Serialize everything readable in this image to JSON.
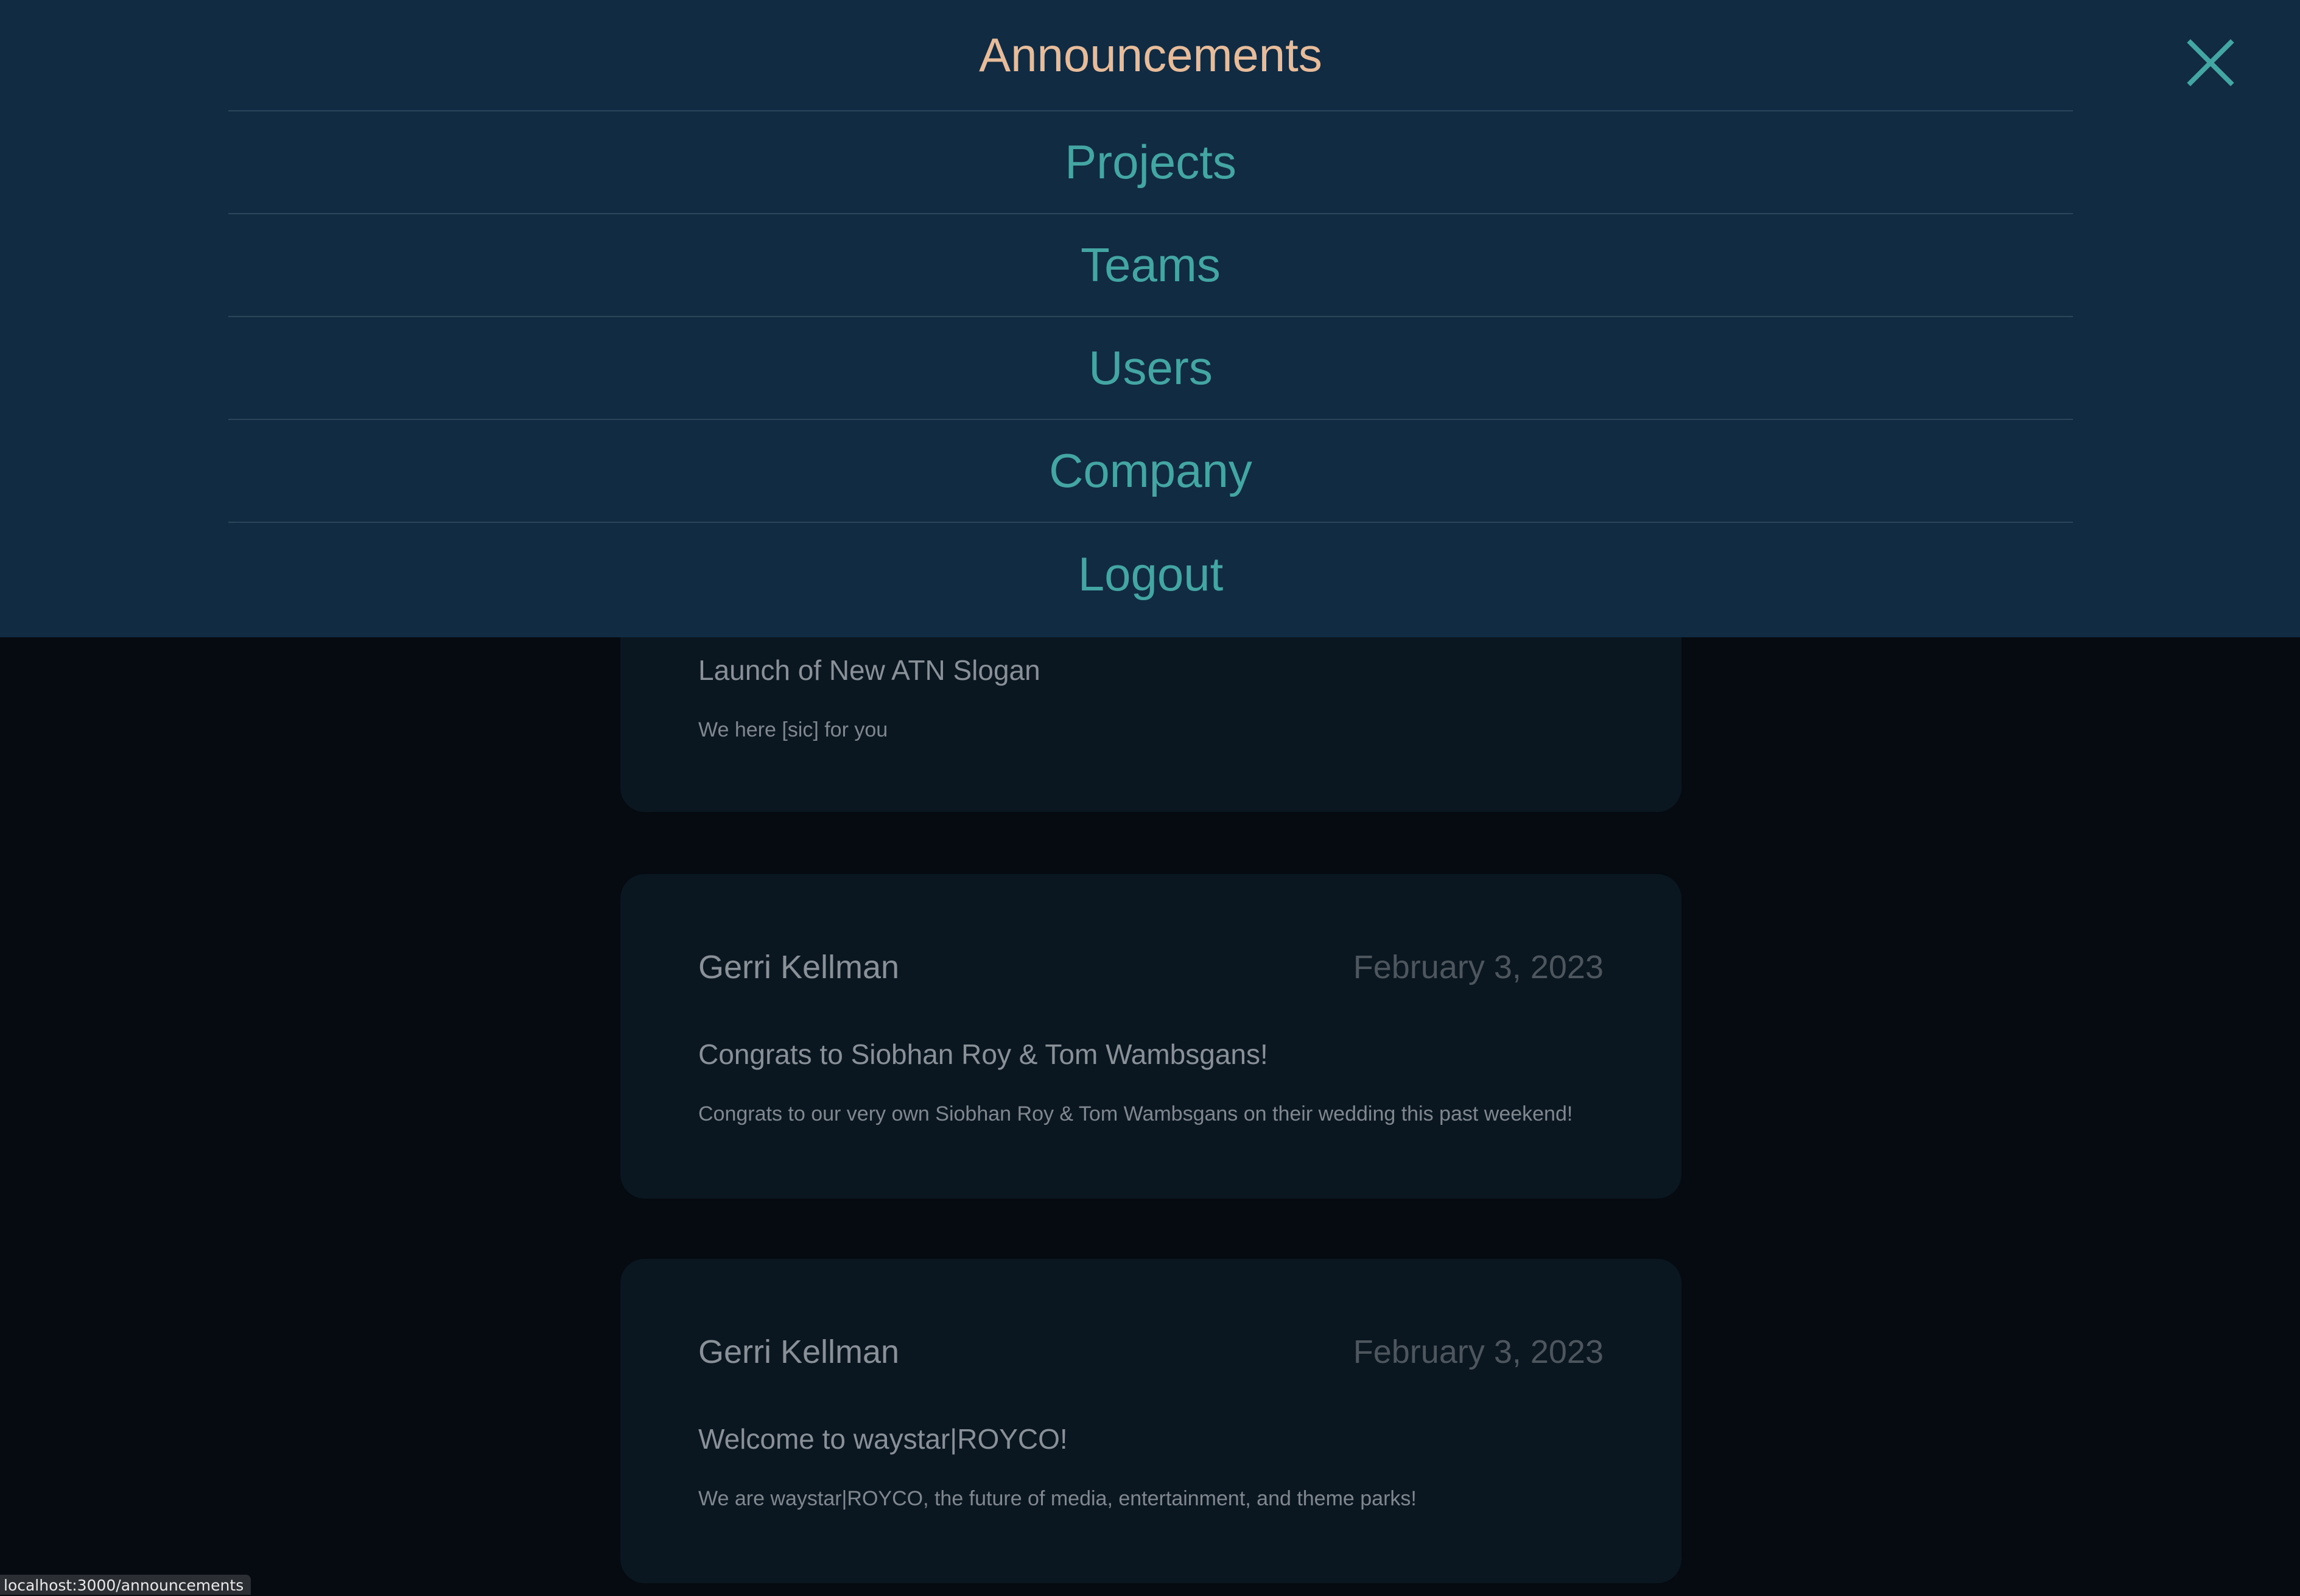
{
  "nav": {
    "items": [
      {
        "label": "Announcements",
        "active": true
      },
      {
        "label": "Projects",
        "active": false
      },
      {
        "label": "Teams",
        "active": false
      },
      {
        "label": "Users",
        "active": false
      },
      {
        "label": "Company",
        "active": false
      },
      {
        "label": "Logout",
        "active": false
      }
    ],
    "close_icon": "close-icon"
  },
  "announcements": [
    {
      "title": "Launch of New ATN Slogan",
      "body": "We here [sic] for you"
    },
    {
      "author": "Gerri Kellman",
      "date": "February 3, 2023",
      "title": "Congrats to Siobhan Roy & Tom Wambsgans!",
      "body": "Congrats to our very own Siobhan Roy & Tom Wambsgans on their wedding this past weekend!"
    },
    {
      "author": "Gerri Kellman",
      "date": "February 3, 2023",
      "title": "Welcome to waystar|ROYCO!",
      "body": "We are waystar|ROYCO, the future of media, entertainment, and theme parks!"
    }
  ],
  "status_bar": {
    "url": "localhost:3000/announcements"
  },
  "colors": {
    "nav_background": "#112b43",
    "nav_link": "#44a6a2",
    "nav_active": "#e7bc9b",
    "page_background": "#050b11",
    "card_background": "#0a1620"
  }
}
